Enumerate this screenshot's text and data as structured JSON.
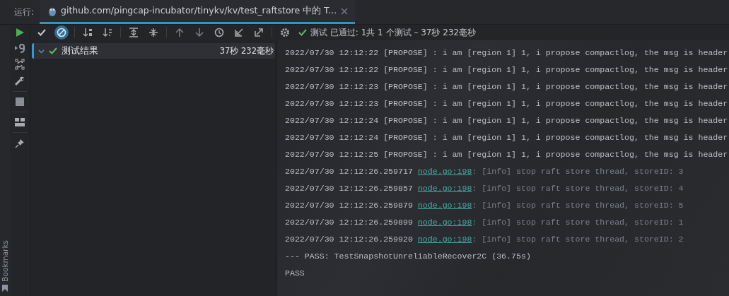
{
  "run_bar": {
    "label": "运行:",
    "tab": {
      "title": "github.com/pingcap-incubator/tinykv/kv/test_raftstore 中的 T...",
      "selected": true
    }
  },
  "toolbar": {
    "filters": [
      {
        "selected": false
      },
      {
        "selected": true
      }
    ],
    "status": {
      "passed": true,
      "text": "测试 已通过: 1共 1 个测试 – 37秒 232毫秒"
    }
  },
  "tree": {
    "items": [
      {
        "label": "测试结果",
        "duration": "37秒 232毫秒",
        "expanded": true,
        "passed": true,
        "selected": true
      }
    ]
  },
  "console": {
    "lines": [
      {
        "kind": "plain",
        "text": "2022/07/30 12:12:22 [PROPOSE] : i am [region 1] 1, i propose compactlog, the msg is header"
      },
      {
        "kind": "plain",
        "text": "2022/07/30 12:12:22 [PROPOSE] : i am [region 1] 1, i propose compactlog, the msg is header"
      },
      {
        "kind": "plain",
        "text": "2022/07/30 12:12:23 [PROPOSE] : i am [region 1] 1, i propose compactlog, the msg is header"
      },
      {
        "kind": "plain",
        "text": "2022/07/30 12:12:23 [PROPOSE] : i am [region 1] 1, i propose compactlog, the msg is header"
      },
      {
        "kind": "plain",
        "text": "2022/07/30 12:12:24 [PROPOSE] : i am [region 1] 1, i propose compactlog, the msg is header"
      },
      {
        "kind": "plain",
        "text": "2022/07/30 12:12:24 [PROPOSE] : i am [region 1] 1, i propose compactlog, the msg is header"
      },
      {
        "kind": "plain",
        "text": "2022/07/30 12:12:25 [PROPOSE] : i am [region 1] 1, i propose compactlog, the msg is header"
      },
      {
        "kind": "info",
        "time": "2022/07/30 12:12:26.259717",
        "link": "node.go:198",
        "message": ": [info] stop raft store thread, storeID: 3"
      },
      {
        "kind": "info",
        "time": "2022/07/30 12:12:26.259857",
        "link": "node.go:198",
        "message": ": [info] stop raft store thread, storeID: 4"
      },
      {
        "kind": "info",
        "time": "2022/07/30 12:12:26.259879",
        "link": "node.go:198",
        "message": ": [info] stop raft store thread, storeID: 5"
      },
      {
        "kind": "info",
        "time": "2022/07/30 12:12:26.259899",
        "link": "node.go:198",
        "message": ": [info] stop raft store thread, storeID: 1"
      },
      {
        "kind": "info",
        "time": "2022/07/30 12:12:26.259920",
        "link": "node.go:198",
        "message": ": [info] stop raft store thread, storeID: 2"
      },
      {
        "kind": "plain",
        "text": "--- PASS: TestSnapshotUnreliableRecover2C (36.75s)"
      },
      {
        "kind": "plain",
        "text": "PASS"
      }
    ]
  },
  "bookmarks": {
    "label": "Bookmarks"
  }
}
